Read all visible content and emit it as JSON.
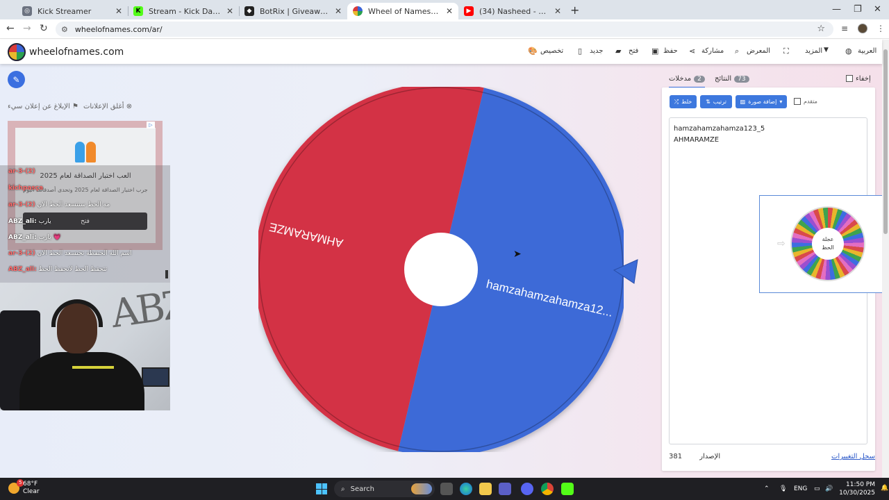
{
  "browser": {
    "tabs": [
      {
        "title": "Kick Streamer",
        "favicon_color": "#6b7280",
        "favicon_icon": "globe-icon"
      },
      {
        "title": "Stream - Kick Dashboard",
        "favicon_color": "#53fc18",
        "favicon_icon": "kick-icon"
      },
      {
        "title": "BotRix | Giveaways",
        "favicon_color": "#222222",
        "favicon_icon": "botrix-icon"
      },
      {
        "title": "Wheel of Names | اسم العشوائي",
        "favicon_color": "#3b6fe0",
        "favicon_icon": "wheel-icon"
      },
      {
        "title": "(34) Nasheed - HUDDIMANA (I",
        "favicon_color": "#ff0000",
        "favicon_icon": "youtube-icon"
      }
    ],
    "active_tab_index": 3,
    "url": "wheelofnames.com/ar/"
  },
  "header": {
    "logo_text": "wheelofnames.com",
    "nav": {
      "customize": "تخصيص",
      "new": "جديد",
      "open": "فتح",
      "save": "حفظ",
      "share": "مشاركة",
      "gallery": "المعرض",
      "more": "المزيد",
      "language": "العربية"
    }
  },
  "ads": {
    "report_link": "الإبلاغ عن إعلان سيء",
    "close_link": "أغلق الإعلانات",
    "title": "العب اختبار الصداقة لعام 2025",
    "subtitle": "جرب اختبار الصداقة لعام 2025 وتحدى أصدقائك اليوم",
    "button": "فتح"
  },
  "chat": [
    {
      "user": "ar-3-(2)",
      "text": ""
    },
    {
      "user": "kichpasça",
      "text": ""
    },
    {
      "user": "ar-3-(2)",
      "text": "مة الحظ سنتسعد الحظ الان"
    },
    {
      "user": "ABZ_ali:",
      "text": "يارب"
    },
    {
      "user": "ABZ_ali:",
      "text": "يارب"
    },
    {
      "user": "ar-3-(2)",
      "text": "اسم الله الحنفظة تحتسعد الحظ الان"
    },
    {
      "user": "ABZ_ali:",
      "text": "تتحقظ الحظ لانحفظ الحظ"
    }
  ],
  "wheel": {
    "colors": {
      "segment_1": "#d33045",
      "segment_2": "#3c6bd7",
      "pointer": "#3c6bd7"
    },
    "segments": [
      {
        "label": "AHMARAMZE",
        "color": "#d33045"
      },
      {
        "label": "hamzahamzahamza12...",
        "color": "#3c6bd7"
      }
    ]
  },
  "panel": {
    "hide_label": "إخفاء",
    "tab_entries": {
      "label": "مدخلات",
      "count": "2"
    },
    "tab_results": {
      "label": "النتائج",
      "count": "73"
    },
    "buttons": {
      "shuffle": "خلط",
      "sort": "ترتيب",
      "add_image": "إضافة صورة"
    },
    "advanced": "متقدم",
    "entries": [
      "hamzahamzahamza123_5",
      "AHMARAMZE"
    ],
    "version_label": "الإصدار",
    "version": "381",
    "changelog": "سجل التغييرات"
  },
  "thumbnail": {
    "center_line1": "عجلة",
    "center_line2": "الحظ"
  },
  "taskbar": {
    "weather_temp": "68°F",
    "weather_desc": "Clear",
    "weather_badge": "5",
    "search_placeholder": "Search",
    "lang": "ENG",
    "time": "11:50 PM",
    "date": "10/30/2025"
  }
}
